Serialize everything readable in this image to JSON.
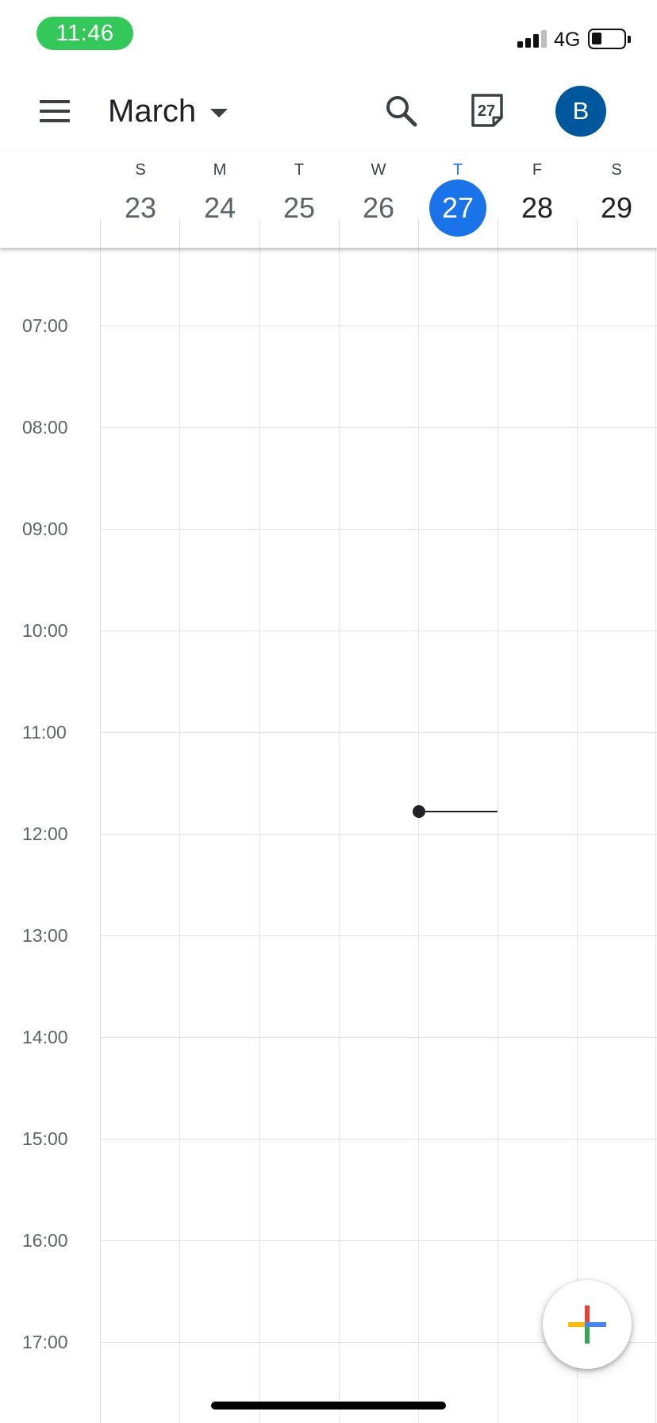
{
  "status_bar": {
    "time": "11:46",
    "network": "4G"
  },
  "app_bar": {
    "month": "March",
    "today_icon_date": "27",
    "avatar_initial": "B"
  },
  "week": {
    "days": [
      {
        "letter": "S",
        "number": "23"
      },
      {
        "letter": "M",
        "number": "24"
      },
      {
        "letter": "T",
        "number": "25"
      },
      {
        "letter": "W",
        "number": "26"
      },
      {
        "letter": "T",
        "number": "27"
      },
      {
        "letter": "F",
        "number": "28"
      },
      {
        "letter": "S",
        "number": "29"
      }
    ]
  },
  "hours": [
    "07:00",
    "08:00",
    "09:00",
    "10:00",
    "11:00",
    "12:00",
    "13:00",
    "14:00",
    "15:00",
    "16:00",
    "17:00"
  ],
  "colors": {
    "today_accent": "#1a73e8",
    "avatar_bg": "#01579b",
    "time_pill": "#34c759",
    "fab_red": "#ea4335",
    "fab_blue": "#4285f4",
    "fab_green": "#34a853",
    "fab_yellow": "#fbbc04"
  },
  "icons": {
    "menu": "menu-icon",
    "dropdown": "caret-down-icon",
    "search": "search-icon",
    "today": "calendar-today-icon",
    "create": "plus-icon"
  }
}
